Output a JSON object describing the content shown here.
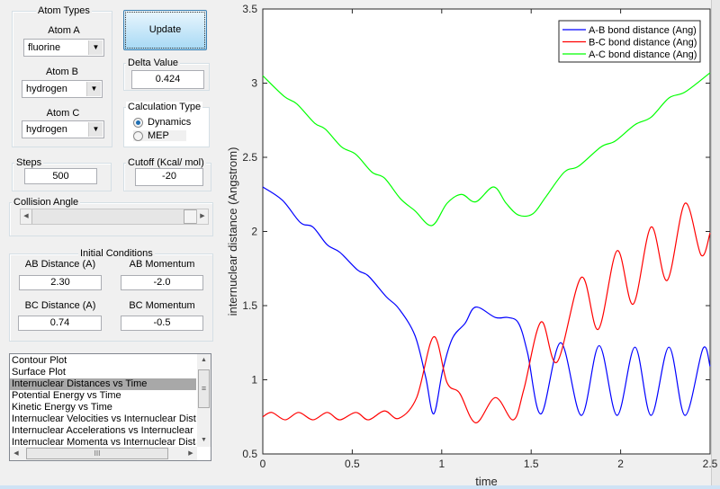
{
  "atom_types": {
    "title": "Atom Types",
    "atom_a": {
      "label": "Atom A",
      "value": "fluorine"
    },
    "atom_b": {
      "label": "Atom B",
      "value": "hydrogen"
    },
    "atom_c": {
      "label": "Atom C",
      "value": "hydrogen"
    }
  },
  "update_button": "Update",
  "delta": {
    "title": "Delta Value",
    "value": "0.424"
  },
  "calc_type": {
    "title": "Calculation Type",
    "options": [
      "Dynamics",
      "MEP"
    ],
    "selected": "Dynamics"
  },
  "steps": {
    "title": "Steps",
    "value": "500"
  },
  "cutoff": {
    "title": "Cutoff (Kcal/ mol)",
    "value": "-20"
  },
  "collision_angle": {
    "title": "Collision Angle",
    "slider_fraction": 0.95
  },
  "initial_conditions": {
    "title": "Initial Conditions",
    "ab_distance": {
      "label": "AB Distance (A)",
      "value": "2.30"
    },
    "ab_momentum": {
      "label": "AB Momentum",
      "value": "-2.0"
    },
    "bc_distance": {
      "label": "BC Distance (A)",
      "value": "0.74"
    },
    "bc_momentum": {
      "label": "BC Momentum",
      "value": "-0.5"
    }
  },
  "plot_list": {
    "items": [
      "Contour Plot",
      "Surface Plot",
      "Internuclear Distances vs Time",
      "Potential Energy vs Time",
      "Kinetic Energy vs Time",
      "Internuclear Velocities vs Internuclear Distance",
      "Internuclear Accelerations vs Internuclear Distance",
      "Internuclear Momenta vs Internuclear Distance"
    ],
    "selected_index": 2,
    "hscroll_grip": "III",
    "vscroll_grip": "≡"
  },
  "chart_data": {
    "type": "line",
    "xlabel": "time",
    "ylabel": "internuclear distance (Angstrom)",
    "xlim": [
      0,
      2.5
    ],
    "ylim": [
      0.5,
      3.5
    ],
    "xticks": [
      "0",
      "0.5",
      "1",
      "1.5",
      "2",
      "2.5"
    ],
    "yticks": [
      "0.5",
      "1",
      "1.5",
      "2",
      "2.5",
      "3",
      "3.5"
    ],
    "grid": false,
    "legend": "top-right",
    "series": [
      {
        "name": "A-B bond distance (Ang)",
        "color": "#0000ff",
        "t": [
          0,
          0.11,
          0.21,
          0.28,
          0.36,
          0.43,
          0.53,
          0.59,
          0.69,
          0.76,
          0.85,
          0.91,
          0.955,
          1.005,
          1.06,
          1.13,
          1.19,
          1.3,
          1.37,
          1.43,
          1.48,
          1.555,
          1.665,
          1.78,
          1.88,
          1.98,
          2.08,
          2.17,
          2.27,
          2.36,
          2.46,
          2.5
        ],
        "v": [
          2.3,
          2.21,
          2.06,
          2.03,
          1.91,
          1.86,
          1.74,
          1.7,
          1.56,
          1.48,
          1.3,
          1.02,
          0.77,
          1.06,
          1.28,
          1.38,
          1.49,
          1.42,
          1.42,
          1.38,
          1.18,
          0.77,
          1.25,
          0.76,
          1.23,
          0.76,
          1.22,
          0.76,
          1.22,
          0.76,
          1.21,
          1.09
        ]
      },
      {
        "name": "B-C bond distance (Ang)",
        "color": "#ff0000",
        "t": [
          0,
          0.05,
          0.125,
          0.2,
          0.28,
          0.36,
          0.43,
          0.52,
          0.59,
          0.68,
          0.76,
          0.86,
          0.955,
          1.03,
          1.1,
          1.19,
          1.3,
          1.4,
          1.46,
          1.555,
          1.645,
          1.78,
          1.875,
          1.98,
          2.07,
          2.17,
          2.26,
          2.36,
          2.45,
          2.5
        ],
        "v": [
          0.75,
          0.78,
          0.73,
          0.78,
          0.73,
          0.78,
          0.73,
          0.78,
          0.73,
          0.79,
          0.74,
          0.88,
          1.29,
          0.98,
          0.91,
          0.71,
          0.88,
          0.73,
          0.94,
          1.39,
          1.12,
          1.69,
          1.34,
          1.87,
          1.51,
          2.03,
          1.67,
          2.19,
          1.84,
          1.99
        ]
      },
      {
        "name": "A-C bond distance (Ang)",
        "color": "#00ff00",
        "t": [
          0,
          0.12,
          0.19,
          0.29,
          0.35,
          0.44,
          0.52,
          0.61,
          0.68,
          0.77,
          0.85,
          0.945,
          1.03,
          1.11,
          1.19,
          1.29,
          1.36,
          1.43,
          1.51,
          1.58,
          1.685,
          1.765,
          1.89,
          1.97,
          2.08,
          2.17,
          2.27,
          2.36,
          2.5
        ],
        "v": [
          3.05,
          2.91,
          2.86,
          2.73,
          2.69,
          2.57,
          2.52,
          2.4,
          2.36,
          2.22,
          2.14,
          2.04,
          2.19,
          2.25,
          2.2,
          2.3,
          2.19,
          2.11,
          2.12,
          2.23,
          2.4,
          2.44,
          2.57,
          2.61,
          2.72,
          2.77,
          2.9,
          2.94,
          3.07
        ]
      }
    ]
  }
}
